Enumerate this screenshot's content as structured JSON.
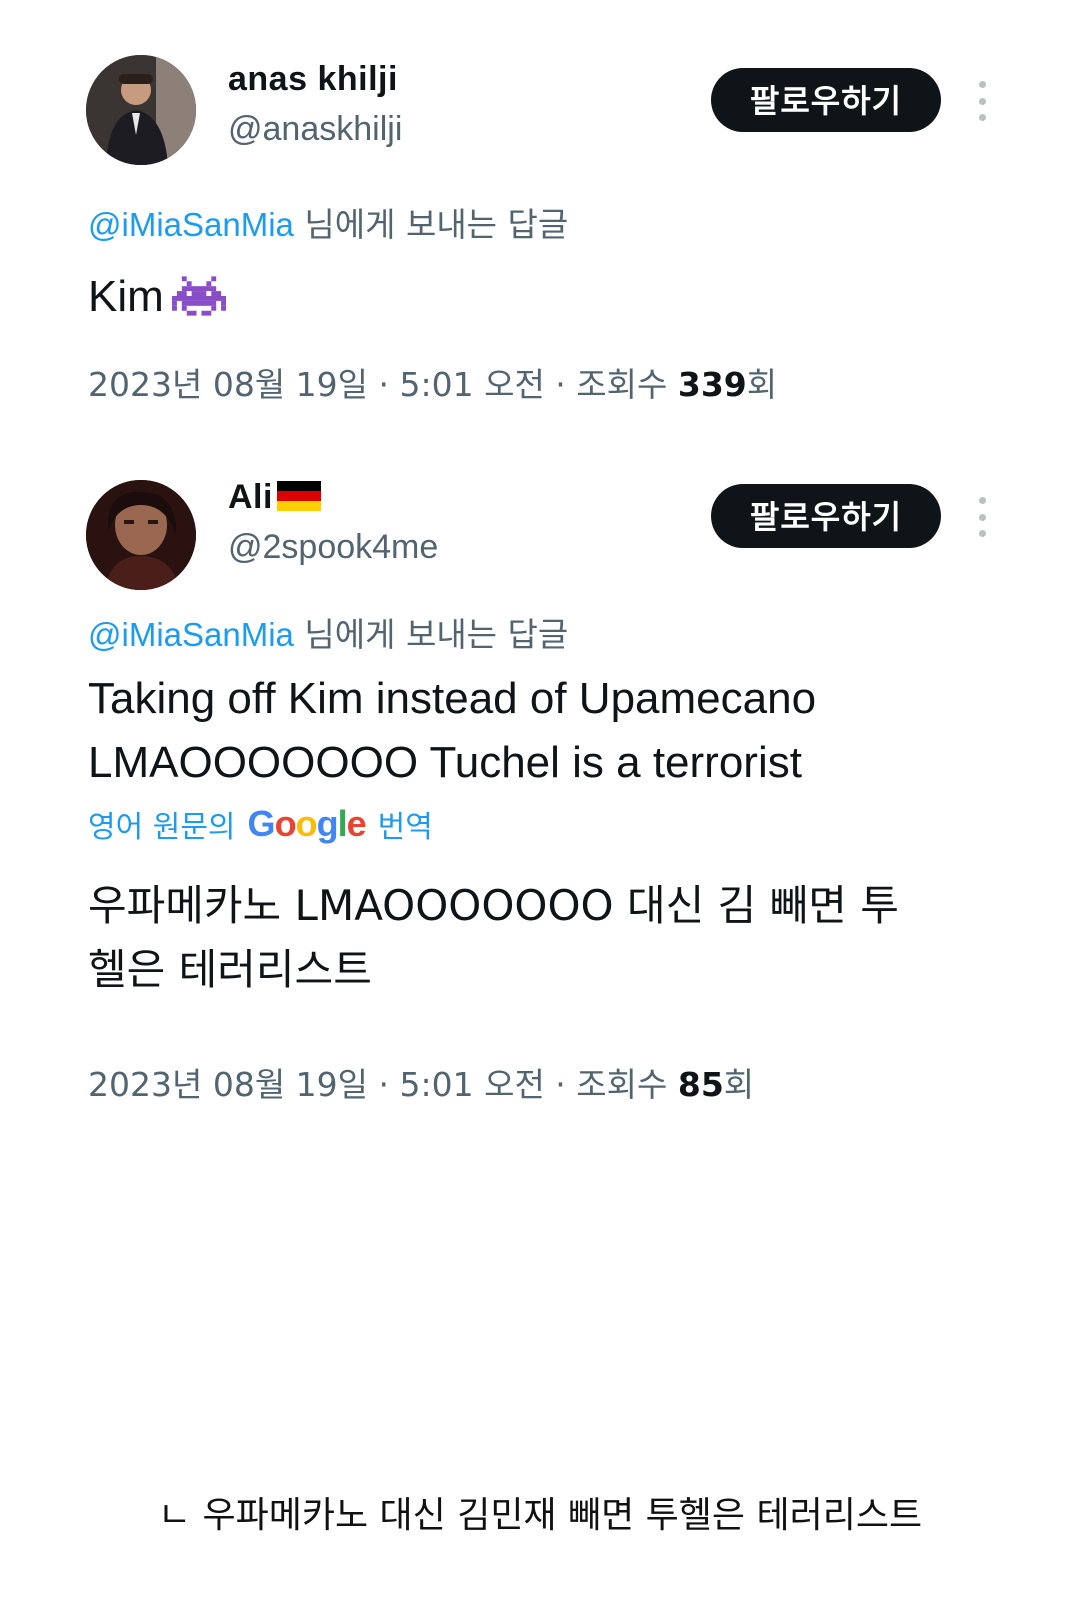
{
  "tweets": [
    {
      "display_name": "anas khilji",
      "handle": "@anaskhilji",
      "follow_label": "팔로우하기",
      "reply_to_mention": "@iMiaSanMia",
      "reply_to_suffix": " 님에게 보내는 답글",
      "text": "Kim",
      "emoji_icon": "alien-monster-icon",
      "date": "2023년 08월 19일 · 5:01 오전 · 조회수 ",
      "views": "339",
      "views_suffix": "회"
    },
    {
      "display_name": "Ali",
      "flag_icon": "germany-flag-icon",
      "handle": "@2spook4me",
      "follow_label": "팔로우하기",
      "reply_to_mention": "@iMiaSanMia",
      "reply_to_suffix": " 님에게 보내는 답글",
      "text": "Taking off Kim instead of Upamecano\nLMAOOOOOOO Tuchel is a terrorist",
      "translate_prefix": "영어 원문의",
      "translate_brand": "Google",
      "translate_suffix": "번역",
      "translated_text": "우파메카노 LMAOOOOOOO 대신 김 빼면 투\n헬은 테러리스트",
      "date": "2023년 08월 19일 · 5:01 오전 · 조회수 ",
      "views": "85",
      "views_suffix": "회"
    }
  ],
  "caption": "ㄴ 우파메카노 대신 김민재 빼면 투헬은 테러리스트",
  "colors": {
    "link": "#1d9bf0",
    "muted": "#536471",
    "button_bg": "#0f1419",
    "text": "#0f1419"
  }
}
